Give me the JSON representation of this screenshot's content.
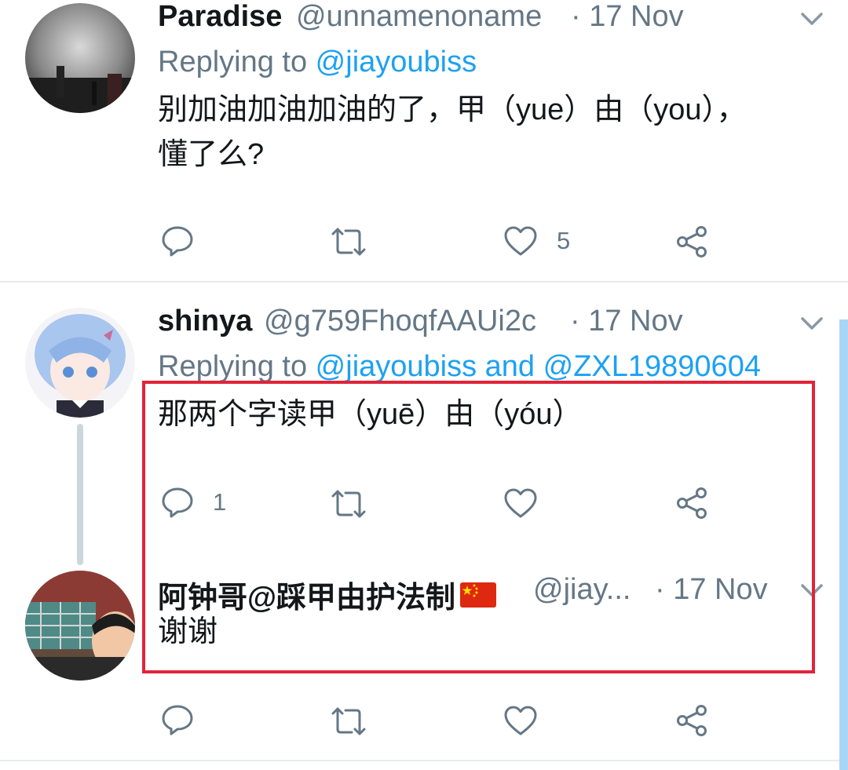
{
  "tweets": [
    {
      "name": "Paradise",
      "handle": "@unnamenoname",
      "date": "· 17 Nov",
      "replying_prefix": "Replying to ",
      "replying_mentions": "@jiayoubiss",
      "text_line1": "别加油加油加油的了，甲（yue）由（you），",
      "text_line2": "懂了么?",
      "actions": {
        "reply_count": "",
        "retweet_count": "",
        "like_count": "5"
      }
    },
    {
      "name": "shinya",
      "handle": "@g759FhoqfAAUi2c",
      "date": "· 17 Nov",
      "replying_prefix": "Replying to ",
      "replying_mentions": "@jiayoubiss and @ZXL19890604",
      "text_line1": "那两个字读甲（yuē）由（yóu）",
      "actions": {
        "reply_count": "1",
        "retweet_count": "",
        "like_count": ""
      }
    },
    {
      "name": "阿钟哥@踩甲由护法制",
      "name_flag": "china-flag-icon",
      "handle": "@jiay...",
      "date": "· 17 Nov",
      "text_line1": "谢谢",
      "actions": {
        "reply_count": "",
        "retweet_count": "",
        "like_count": ""
      }
    }
  ],
  "colors": {
    "link": "#1da1f2",
    "secondary_text": "#657786",
    "highlight_border": "#e1243a",
    "thread_line": "#ccd6dd"
  }
}
